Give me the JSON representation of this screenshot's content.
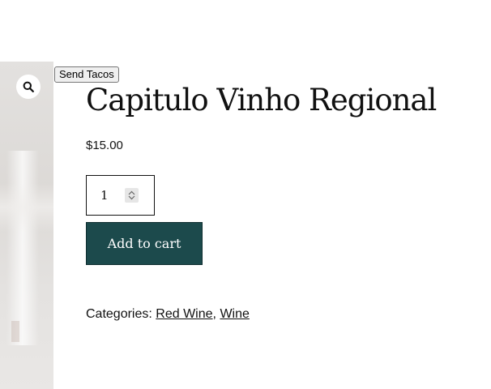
{
  "gallery": {
    "zoom_icon": "search-icon"
  },
  "send_tacos": {
    "label": "Send Tacos"
  },
  "product": {
    "title": "Capitulo Vinho Regional",
    "price": "$15.00",
    "quantity": "1",
    "add_to_cart_label": "Add to cart",
    "button_color": "#1c4a4c"
  },
  "meta": {
    "categories_label": "Categories:",
    "categories": [
      "Red Wine",
      "Wine"
    ],
    "separator": ","
  }
}
